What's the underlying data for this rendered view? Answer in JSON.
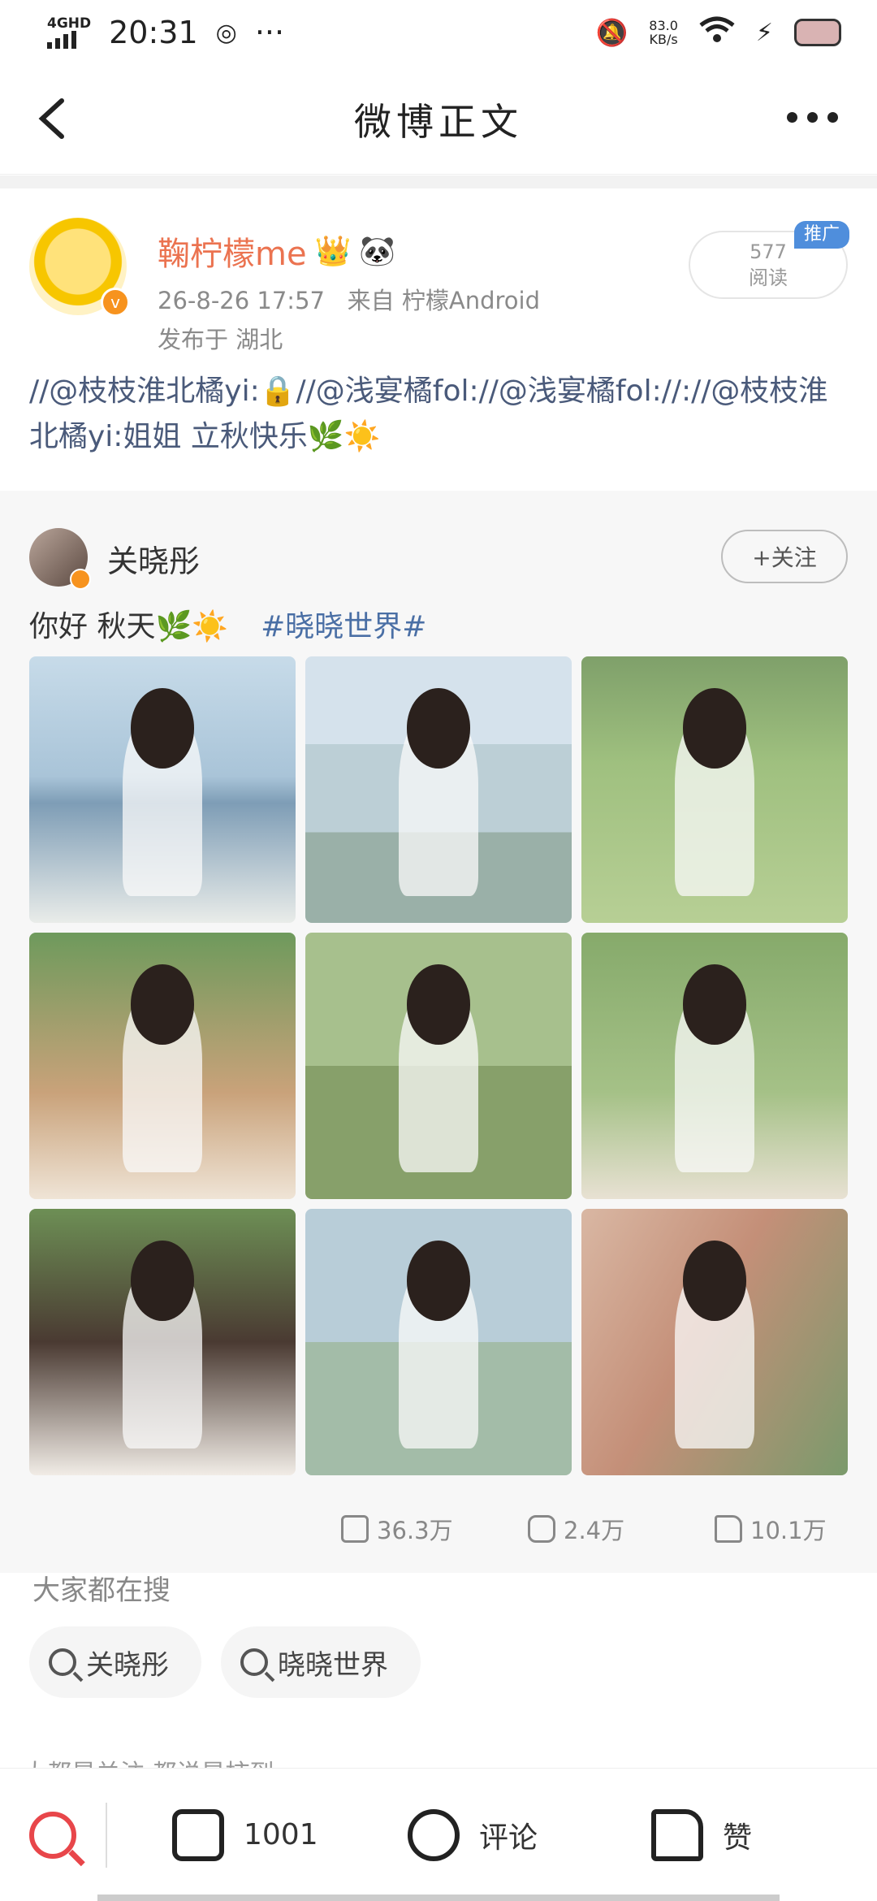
{
  "status_bar": {
    "network": "4GHD",
    "time": "20:31",
    "speed_value": "83.0",
    "speed_unit": "KB/s"
  },
  "nav": {
    "title": "微博正文"
  },
  "post": {
    "username": "鞠柠檬me",
    "time": "26-8-26 17:57",
    "source": "来自 柠檬Android",
    "location": "发布于 湖北",
    "read_count": "577",
    "read_label": "阅读",
    "promo_label": "推广",
    "text": "//@枝枝淮北橘yi:🔒//@浅宴橘fol://@浅宴橘fol://://@枝枝淮北橘yi:姐姐 立秋快乐🌿☀️"
  },
  "repost": {
    "username": "关晓彤",
    "follow_label": "+关注",
    "text": "你好 秋天🌿☀️",
    "hashtag": "#晓晓世界#",
    "shares": "36.3万",
    "comments": "2.4万",
    "likes": "10.1万"
  },
  "search": {
    "title": "大家都在搜",
    "chips": [
      "关晓彤",
      "晓晓世界"
    ]
  },
  "cut_text": "大都是关注 都说是柿到",
  "bottom_bar": {
    "share_count": "1001",
    "comment_label": "评论",
    "like_label": "赞"
  },
  "colors": {
    "username_orange": "#eb7350",
    "link_blue": "#4a6fa5",
    "search_red": "#e8464a",
    "promo_blue": "#4f8edc"
  }
}
